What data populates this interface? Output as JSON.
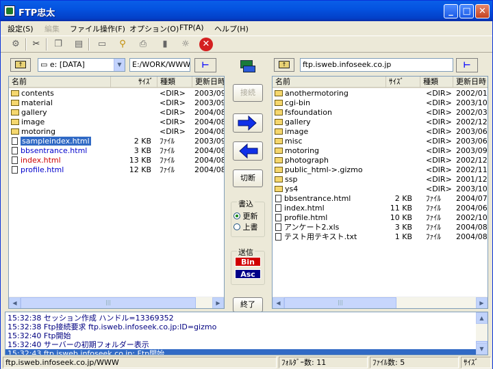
{
  "window": {
    "title": "FTP忠太"
  },
  "menu": [
    "設定(S)",
    "編集",
    "ファイル操作(F)",
    "オプション(O)",
    "FTP(A)",
    "ヘルプ(H)"
  ],
  "colors": {
    "accent": "#0a5fe8",
    "selection": "#316ac5",
    "log_text": "#000080",
    "html_red": "#cc0000",
    "html_blue": "#0000cc"
  },
  "toolbar": {
    "icons": [
      "connect-icon",
      "cut-icon",
      "copy-icon",
      "paste-icon",
      "rename-icon",
      "find-icon",
      "print-icon",
      "stop-icon",
      "properties-icon",
      "cancel-icon"
    ]
  },
  "left": {
    "drive": "e: [DATA]",
    "path": "E:/WORK/WWW",
    "headers": [
      "名前",
      "ｻｲｽﾞ",
      "種類",
      "更新日時"
    ],
    "rows": [
      {
        "name": "contents",
        "size": "",
        "type": "<DIR>",
        "date": "2003/09",
        "kind": "folder"
      },
      {
        "name": "material",
        "size": "",
        "type": "<DIR>",
        "date": "2003/09",
        "kind": "folder"
      },
      {
        "name": "gallery",
        "size": "",
        "type": "<DIR>",
        "date": "2004/08",
        "kind": "folder"
      },
      {
        "name": "image",
        "size": "",
        "type": "<DIR>",
        "date": "2004/08",
        "kind": "folder"
      },
      {
        "name": "motoring",
        "size": "",
        "type": "<DIR>",
        "date": "2004/08",
        "kind": "folder"
      },
      {
        "name": "sampleindex.html",
        "size": "2 KB",
        "type": "ﾌｧｲﾙ",
        "date": "2003/09",
        "kind": "file",
        "selected": true
      },
      {
        "name": "bbsentrance.html",
        "size": "3 KB",
        "type": "ﾌｧｲﾙ",
        "date": "2004/08",
        "kind": "file",
        "color": "blue"
      },
      {
        "name": "index.html",
        "size": "13 KB",
        "type": "ﾌｧｲﾙ",
        "date": "2004/08",
        "kind": "file",
        "color": "red"
      },
      {
        "name": "profile.html",
        "size": "12 KB",
        "type": "ﾌｧｲﾙ",
        "date": "2004/08",
        "kind": "file",
        "color": "blue"
      }
    ]
  },
  "right": {
    "path": "ftp.isweb.infoseek.co.jp",
    "headers": [
      "名前",
      "ｻｲｽﾞ",
      "種類",
      "更新日時"
    ],
    "rows": [
      {
        "name": "anothermotoring",
        "size": "",
        "type": "<DIR>",
        "date": "2002/01",
        "kind": "folder"
      },
      {
        "name": "cgi-bin",
        "size": "",
        "type": "<DIR>",
        "date": "2003/10",
        "kind": "folder"
      },
      {
        "name": "fsfoundation",
        "size": "",
        "type": "<DIR>",
        "date": "2002/03",
        "kind": "folder"
      },
      {
        "name": "gallery",
        "size": "",
        "type": "<DIR>",
        "date": "2002/12",
        "kind": "folder"
      },
      {
        "name": "image",
        "size": "",
        "type": "<DIR>",
        "date": "2003/06",
        "kind": "folder"
      },
      {
        "name": "misc",
        "size": "",
        "type": "<DIR>",
        "date": "2003/06",
        "kind": "folder"
      },
      {
        "name": "motoring",
        "size": "",
        "type": "<DIR>",
        "date": "2003/09",
        "kind": "folder"
      },
      {
        "name": "photograph",
        "size": "",
        "type": "<DIR>",
        "date": "2002/12",
        "kind": "folder"
      },
      {
        "name": "public_html->.gizmo",
        "size": "",
        "type": "<DIR>",
        "date": "2002/11",
        "kind": "folder"
      },
      {
        "name": "ssp",
        "size": "",
        "type": "<DIR>",
        "date": "2001/12",
        "kind": "folder"
      },
      {
        "name": "ys4",
        "size": "",
        "type": "<DIR>",
        "date": "2003/10",
        "kind": "folder"
      },
      {
        "name": "bbsentrance.html",
        "size": "2 KB",
        "type": "ﾌｧｲﾙ",
        "date": "2004/07",
        "kind": "file"
      },
      {
        "name": "index.html",
        "size": "11 KB",
        "type": "ﾌｧｲﾙ",
        "date": "2004/06",
        "kind": "file"
      },
      {
        "name": "profile.html",
        "size": "10 KB",
        "type": "ﾌｧｲﾙ",
        "date": "2002/10",
        "kind": "file"
      },
      {
        "name": "アンケート2.xls",
        "size": "3 KB",
        "type": "ﾌｧｲﾙ",
        "date": "2004/08",
        "kind": "file"
      },
      {
        "name": "テスト用テキスト.txt",
        "size": "1 KB",
        "type": "ﾌｧｲﾙ",
        "date": "2004/08",
        "kind": "file"
      }
    ]
  },
  "middle": {
    "connect": "接続",
    "disconnect": "切断",
    "write_label": "書込",
    "update": "更新",
    "overwrite": "上書",
    "send_label": "送信",
    "bin": "Bin",
    "asc": "Asc",
    "exit": "終了"
  },
  "log": [
    "15:32:38  セッション作成 ハンドル=13369352",
    "15:32:38  Ftp接続要求 ftp.isweb.infoseek.co.jp:ID=gizmo",
    "15:32:40  Ftp開始",
    "15:32:40  サーバーの初期フォルダー表示",
    "15:32:43  ftp.isweb.infoseek.co.jp: Ftp開始"
  ],
  "status": {
    "path": "ftp.isweb.infoseek.co.jp/WWW",
    "folders": "ﾌｫﾙﾀﾞｰ数: 11",
    "files": "ﾌｧｲﾙ数: 5",
    "size": "ｻｲｽﾞ"
  }
}
